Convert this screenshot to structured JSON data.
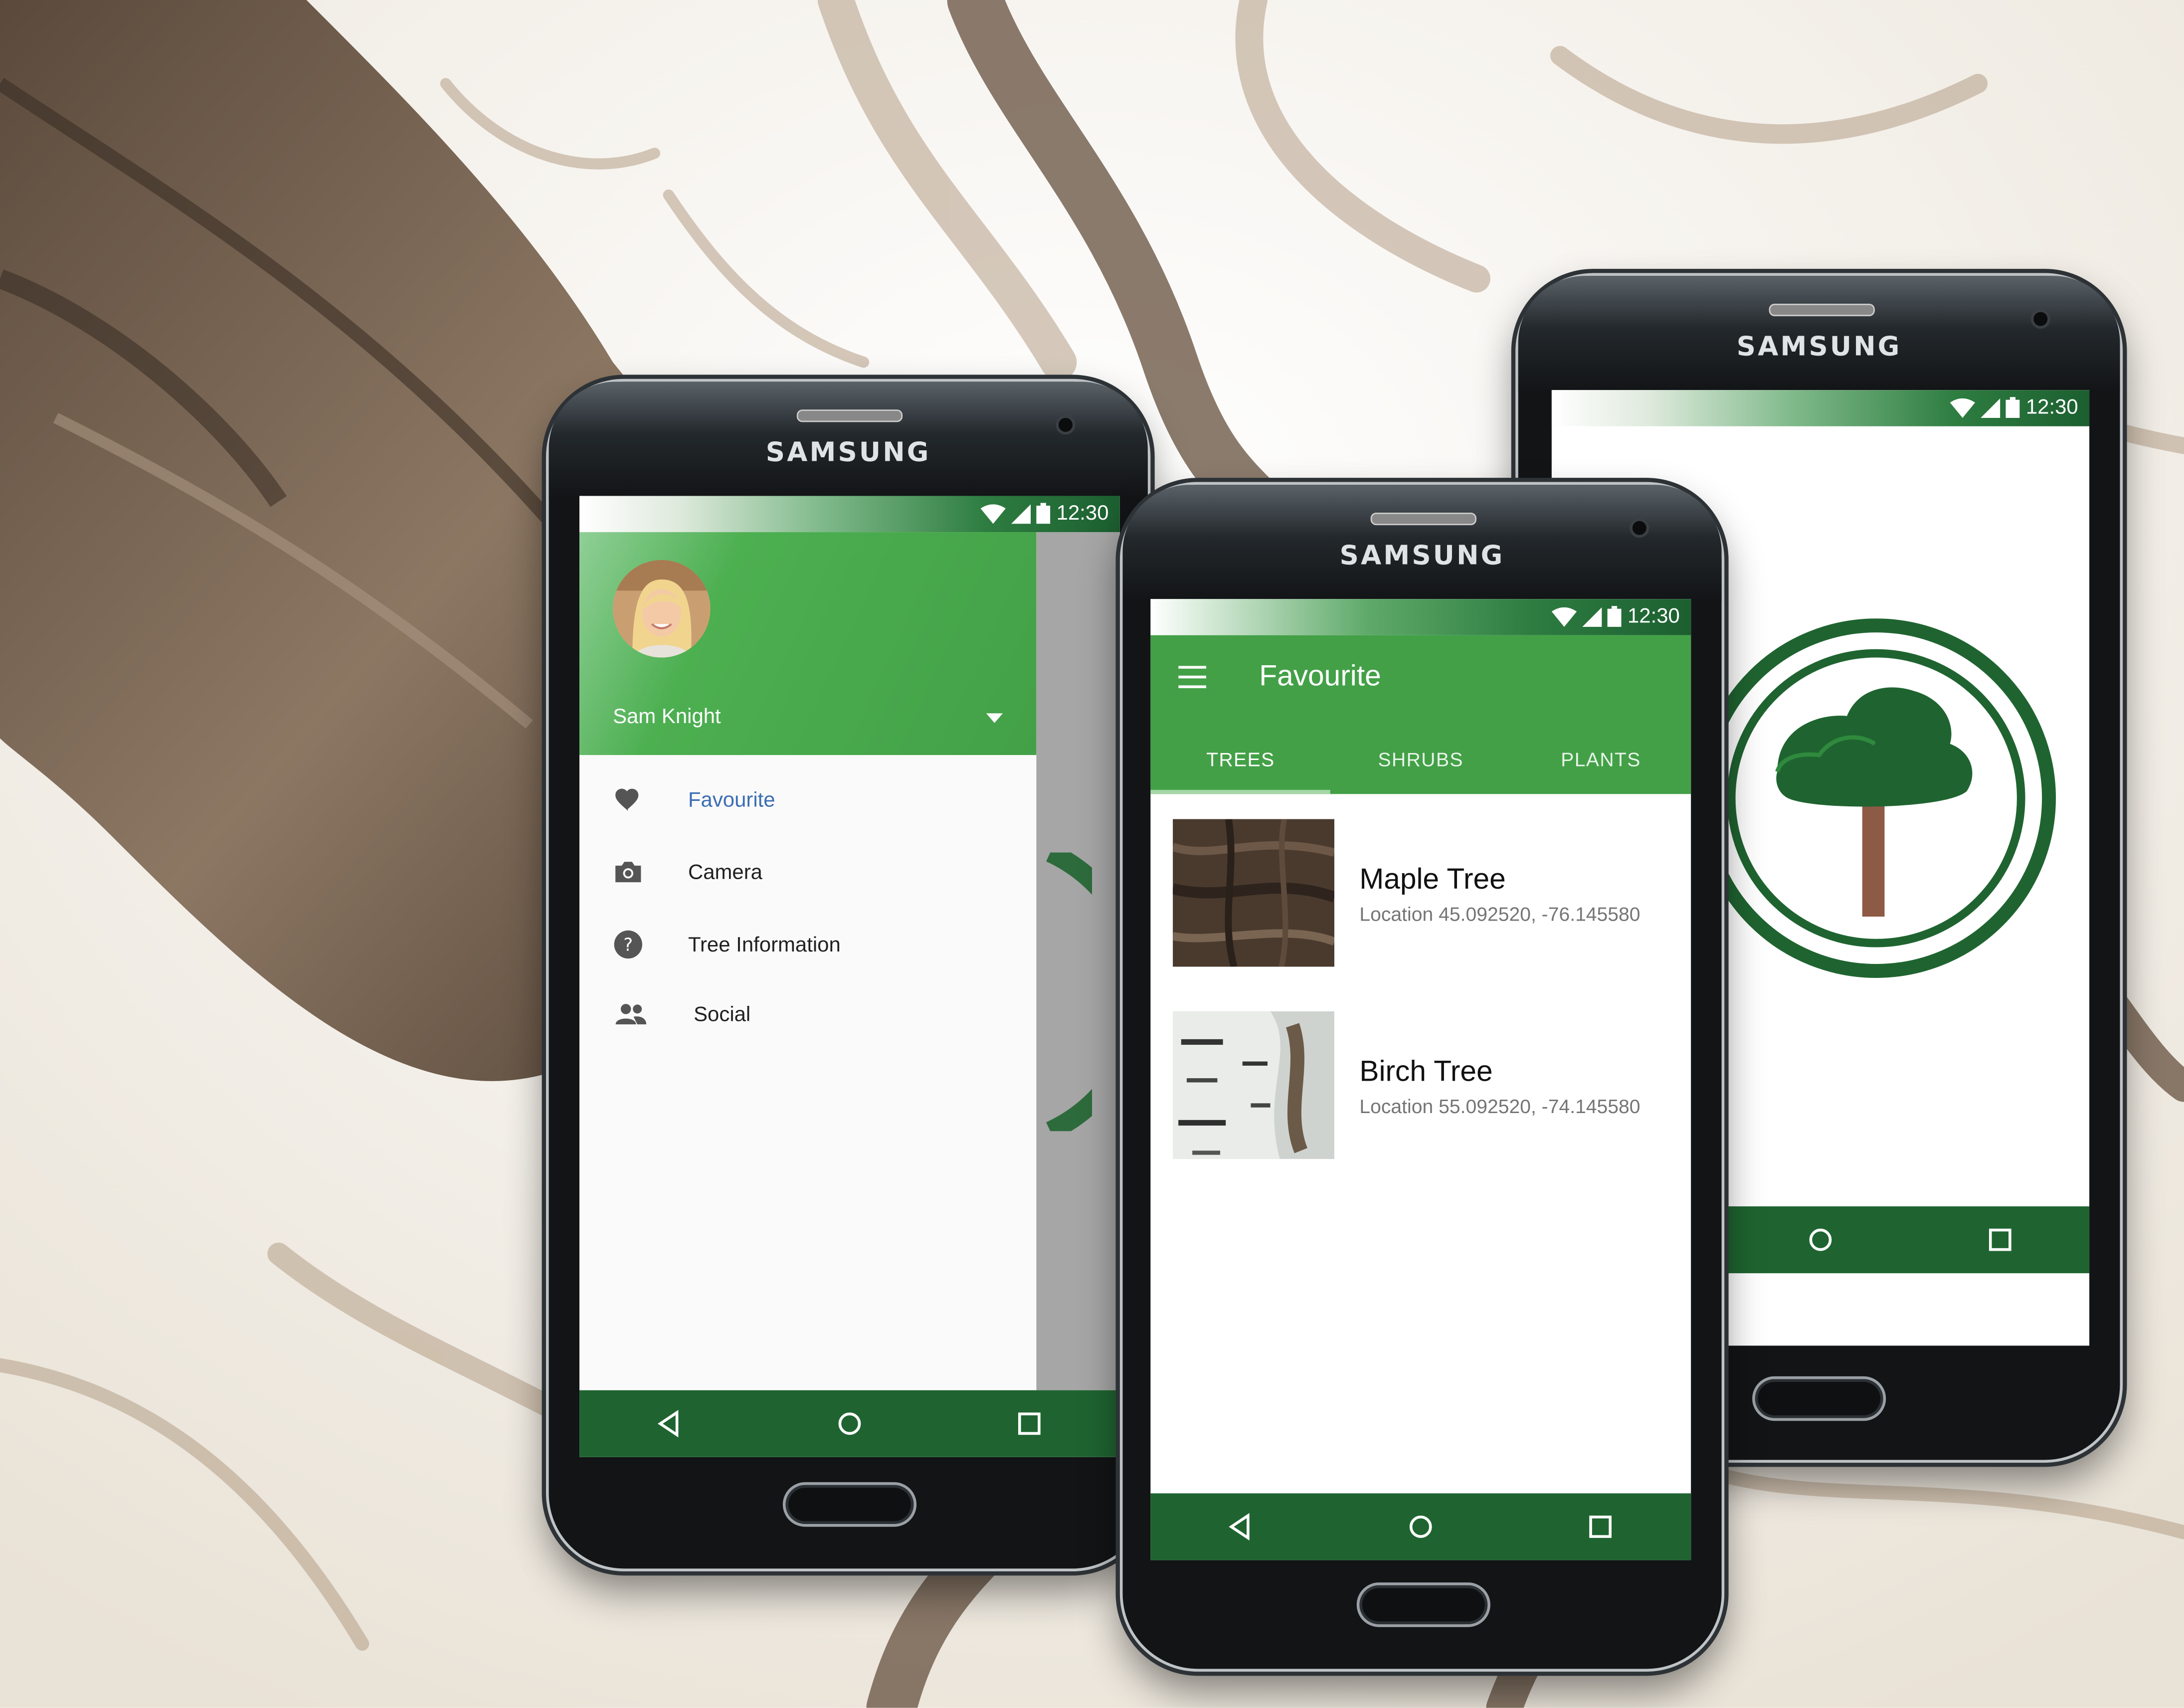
{
  "colors": {
    "primary": "#43a047",
    "primary_dark": "#1f6430",
    "accent_text": "#3b6db4"
  },
  "phones": [
    {
      "brand": "SAMSUNG",
      "status_time": "12:30",
      "drawer": {
        "user_name": "Sam Knight",
        "items": [
          {
            "label": "Favourite",
            "icon": "heart-icon"
          },
          {
            "label": "Camera",
            "icon": "camera-icon"
          },
          {
            "label": "Tree Information",
            "icon": "help-icon"
          },
          {
            "label": "Social",
            "icon": "people-icon"
          }
        ]
      }
    },
    {
      "brand": "SAMSUNG",
      "status_time": "12:30",
      "title": "Favourite",
      "tabs": [
        "TREES",
        "SHRUBS",
        "PLANTS"
      ],
      "list": [
        {
          "name": "Maple Tree",
          "location": "Location 45.092520, -76.145580"
        },
        {
          "name": "Birch Tree",
          "location": "Location 55.092520, -74.145580"
        }
      ]
    },
    {
      "brand": "SAMSUNG",
      "status_time": "12:30"
    }
  ]
}
